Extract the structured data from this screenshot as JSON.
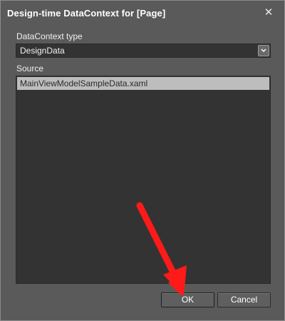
{
  "window": {
    "title": "Design-time DataContext for [Page]",
    "close_glyph": "✕",
    "close_icon": "close-icon"
  },
  "form": {
    "datacontext_type_label": "DataContext type",
    "datacontext_type_value": "DesignData",
    "dropdown_icon": "chevron-down-icon",
    "dropdown_glyph": "⌄",
    "source_label": "Source",
    "source_items": [
      "MainViewModelSampleData.xaml"
    ]
  },
  "buttons": {
    "ok_label": "OK",
    "cancel_label": "Cancel"
  },
  "annotation": {
    "arrow_color": "#ff1a1a",
    "arrow_icon": "red-annotation-arrow"
  },
  "colors": {
    "dialog_bg": "#5a5a5a",
    "field_bg": "#333333",
    "selected_item_bg": "#bdbdbd"
  }
}
